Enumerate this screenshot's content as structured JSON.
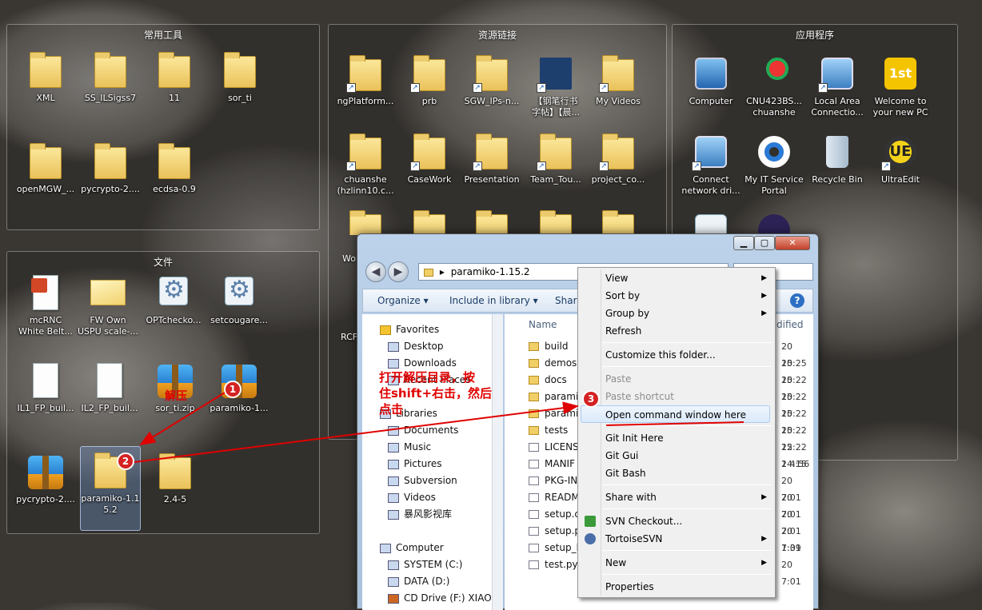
{
  "groups": {
    "tools": {
      "title": "常用工具"
    },
    "links": {
      "title": "资源链接"
    },
    "apps": {
      "title": "应用程序"
    },
    "files": {
      "title": "文件"
    }
  },
  "tools_icons": [
    {
      "label": "XML",
      "icon": "folder-icon"
    },
    {
      "label": "SS_ILSigss7",
      "icon": "folder-icon"
    },
    {
      "label": "11",
      "icon": "folder-icon"
    },
    {
      "label": "sor_ti",
      "icon": "folder-icon"
    },
    {
      "label": "openMGW_...",
      "icon": "folder-icon"
    },
    {
      "label": "pycrypto-2....",
      "icon": "folder-icon"
    },
    {
      "label": "ecdsa-0.9",
      "icon": "folder-icon"
    }
  ],
  "link_icons": [
    {
      "label": "ngPlatform...",
      "icon": "folder-icon"
    },
    {
      "label": "prb",
      "icon": "folder-icon"
    },
    {
      "label": "SGW_IPs-n...",
      "icon": "folder-icon"
    },
    {
      "label": "【钢笔行书\n字帖】【晨...",
      "icon": "book-icon"
    },
    {
      "label": "My Videos",
      "icon": "folder-icon"
    },
    {
      "label": "chuanshe\n(hzlinn10.c...",
      "icon": "folder-icon"
    },
    {
      "label": "CaseWork",
      "icon": "folder-icon"
    },
    {
      "label": "Presentation",
      "icon": "folder-icon"
    },
    {
      "label": "Team_Tou...",
      "icon": "folder-icon"
    },
    {
      "label": "project_co...",
      "icon": "folder-icon"
    }
  ],
  "app_icons": [
    {
      "label": "Computer",
      "icon": "computer-icon"
    },
    {
      "label": "CNU423BS...\nchuanshe",
      "icon": "network-user-icon"
    },
    {
      "label": "Local Area\nConnectio...",
      "icon": "network-icon"
    },
    {
      "label": "Welcome to\nyour new PC",
      "icon": "welcome-icon"
    },
    {
      "label": "Connect\nnetwork dri...",
      "icon": "network-drive-icon"
    },
    {
      "label": "My IT Service\nPortal",
      "icon": "lifebuoy-icon"
    },
    {
      "label": "Recycle Bin",
      "icon": "recycle-bin-icon"
    },
    {
      "label": "UltraEdit",
      "icon": "ultraedit-icon"
    }
  ],
  "file_icons": [
    {
      "label": "mcRNC\nWhite Belt...",
      "icon": "ppt-icon"
    },
    {
      "label": "FW Own\nUSPU scale-...",
      "icon": "mail-icon"
    },
    {
      "label": "OPTchecko...",
      "icon": "settings-file-icon"
    },
    {
      "label": "setcougare...",
      "icon": "settings-file-icon"
    },
    {
      "label": "IL1_FP_buil...",
      "icon": "document-icon"
    },
    {
      "label": "IL2_FP_buil...",
      "icon": "document-icon"
    },
    {
      "label": "sor_ti.zip",
      "icon": "zip-icon"
    },
    {
      "label": "paramiko-1...",
      "icon": "zip-icon"
    },
    {
      "label": "pycrypto-2....",
      "icon": "zip-icon"
    },
    {
      "label": "paramiko-1.1\n5.2",
      "icon": "folder-icon"
    },
    {
      "label": "2.4-5",
      "icon": "folder-icon"
    }
  ],
  "partial_labels": {
    "wo": "Wo",
    "rcf": "RCF"
  },
  "explorer": {
    "controls": {
      "minimize": "▁",
      "maximize": "▢",
      "close": "✕"
    },
    "nav": {
      "back": "◀",
      "forward": "▶",
      "breadcrumb_sep": "▸"
    },
    "address": "paramiko-1.15.2",
    "toolbar": {
      "organize": "Organize ▾",
      "include": "Include in library ▾",
      "share": "Share",
      "help": "?"
    },
    "nav_pane": [
      {
        "label": "Favorites",
        "icon": "star-icon"
      },
      {
        "label": "Desktop",
        "icon": "desktop-icon"
      },
      {
        "label": "Downloads",
        "icon": "downloads-icon"
      },
      {
        "label": "Recent Places",
        "icon": "recent-icon"
      },
      {
        "label": "Libraries",
        "icon": "libraries-icon"
      },
      {
        "label": "Documents",
        "icon": "documents-icon"
      },
      {
        "label": "Music",
        "icon": "music-icon"
      },
      {
        "label": "Pictures",
        "icon": "pictures-icon"
      },
      {
        "label": "Subversion",
        "icon": "subversion-icon"
      },
      {
        "label": "Videos",
        "icon": "videos-icon"
      },
      {
        "label": "暴风影视库",
        "icon": "video-library-icon"
      },
      {
        "label": "Computer",
        "icon": "computer-icon"
      },
      {
        "label": "SYSTEM (C:)",
        "icon": "drive-icon"
      },
      {
        "label": "DATA (D:)",
        "icon": "drive-icon"
      },
      {
        "label": "CD Drive (F:) XIAOMI",
        "icon": "cd-drive-icon"
      }
    ],
    "column_name": "Name",
    "column_modified": "dified",
    "files": [
      {
        "name": "build",
        "date": "20 15:25",
        "type": "folder"
      },
      {
        "name": "demos",
        "date": "20 15:22",
        "type": "folder"
      },
      {
        "name": "docs",
        "date": "20 15:22",
        "type": "folder"
      },
      {
        "name": "parami",
        "date": "20 15:22",
        "type": "folder"
      },
      {
        "name": "parami",
        "date": "20 15:22",
        "type": "folder"
      },
      {
        "name": "tests",
        "date": "20 15:22",
        "type": "folder"
      },
      {
        "name": "LICENS",
        "date": "22 14:15",
        "type": "file"
      },
      {
        "name": "MANIF",
        "date": "2 4:56",
        "type": "file"
      },
      {
        "name": "PKG-IN",
        "date": "20 7:01",
        "type": "file"
      },
      {
        "name": "READM",
        "date": "20 7:01",
        "type": "file"
      },
      {
        "name": "setup.c",
        "date": "20 7:01",
        "type": "file"
      },
      {
        "name": "setup.p",
        "date": "20 7:01",
        "type": "file"
      },
      {
        "name": "setup_h",
        "date": "1:39",
        "type": "file"
      },
      {
        "name": "test.py",
        "date": "20 7:01",
        "type": "file"
      }
    ]
  },
  "context_menu": {
    "items": [
      {
        "label": "View",
        "submenu": true
      },
      {
        "label": "Sort by",
        "submenu": true
      },
      {
        "label": "Group by",
        "submenu": true
      },
      {
        "label": "Refresh",
        "submenu": false
      },
      {
        "label": "Customize this folder...",
        "submenu": false
      },
      {
        "label": "Paste",
        "submenu": false,
        "disabled": true
      },
      {
        "label": "Paste shortcut",
        "submenu": false,
        "disabled": true
      },
      {
        "label": "Open command window here",
        "submenu": false,
        "highlighted": true
      },
      {
        "label": "Git Init Here",
        "submenu": false
      },
      {
        "label": "Git Gui",
        "submenu": false
      },
      {
        "label": "Git Bash",
        "submenu": false
      },
      {
        "label": "Share with",
        "submenu": true
      },
      {
        "label": "SVN Checkout...",
        "submenu": false
      },
      {
        "label": "TortoiseSVN",
        "submenu": true
      },
      {
        "label": "New",
        "submenu": true
      },
      {
        "label": "Properties",
        "submenu": false
      }
    ],
    "submenu_arrow": "▶"
  },
  "annotations": {
    "step1": "1",
    "step2": "2",
    "step3": "3",
    "unzip_label": "解压",
    "instruction": "打开解压目录，按\n住shift+右击，然后\n点击"
  },
  "colors": {
    "annotation_red": "#e00000",
    "highlight": "#dbeafb"
  }
}
